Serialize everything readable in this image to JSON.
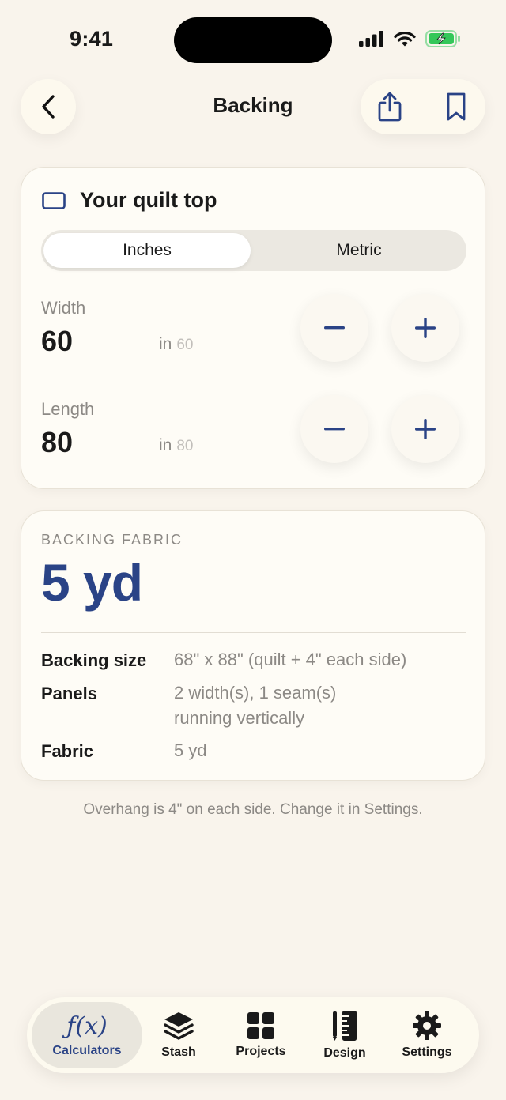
{
  "status": {
    "time": "9:41"
  },
  "nav": {
    "title": "Backing"
  },
  "quilt_top": {
    "title": "Your quilt top",
    "units": {
      "options": [
        "Inches",
        "Metric"
      ],
      "selected": "Inches"
    },
    "width": {
      "label": "Width",
      "value": "60",
      "unit": "in",
      "hint": "60"
    },
    "length": {
      "label": "Length",
      "value": "80",
      "unit": "in",
      "hint": "80"
    }
  },
  "result": {
    "section_label": "BACKING FABRIC",
    "value": "5 yd",
    "rows": [
      {
        "label": "Backing size",
        "value": "68\" x 88\" (quilt + 4\" each side)"
      },
      {
        "label": "Panels",
        "value": "2 width(s), 1 seam(s)",
        "value2": "running vertically"
      },
      {
        "label": "Fabric",
        "value": "5 yd"
      }
    ]
  },
  "footnote": "Overhang is 4\" on each side. Change it in Settings.",
  "tabs": [
    {
      "label": "Calculators",
      "icon": "function-icon",
      "active": true
    },
    {
      "label": "Stash",
      "icon": "stack-icon"
    },
    {
      "label": "Projects",
      "icon": "grid-icon"
    },
    {
      "label": "Design",
      "icon": "ruler-icon"
    },
    {
      "label": "Settings",
      "icon": "gear-icon"
    }
  ],
  "colors": {
    "accent": "#2a4386",
    "background": "#f9f4ec",
    "card": "#fefcf6",
    "battery": "#34c759"
  }
}
